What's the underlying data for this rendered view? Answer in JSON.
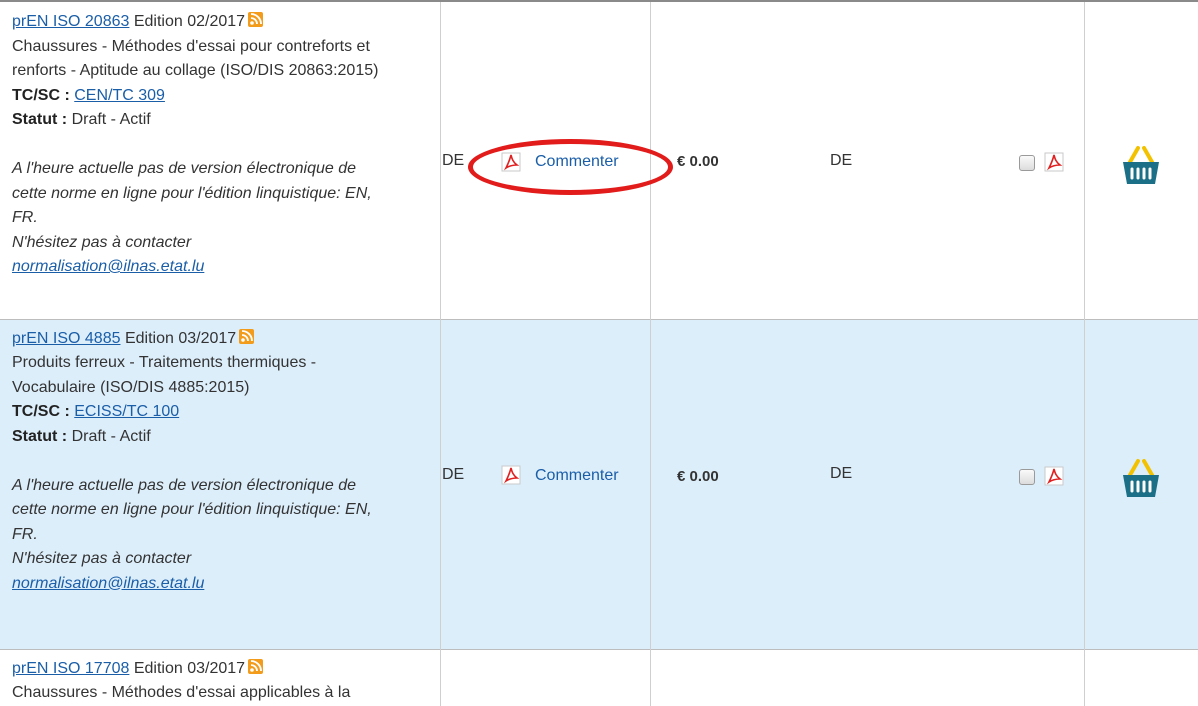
{
  "rows": [
    {
      "std_link": "prEN ISO 20863",
      "edition": "Edition 02/2017",
      "title_lines": [
        "Chaussures - Méthodes d'essai pour contreforts et",
        "renforts - Aptitude au collage (ISO/DIS 20863:2015)"
      ],
      "tc_label": "TC/SC :",
      "tc_link": "CEN/TC 309",
      "status_label": "Statut :",
      "status_value": "Draft - Actif",
      "note_lines": [
        "A l'heure actuelle pas de version électronique de",
        "cette norme en ligne pour l'édition linquistique: EN,",
        "FR.",
        "N'hésitez pas à contacter"
      ],
      "email": "normalisation@ilnas.etat.lu",
      "lang": "DE",
      "commenter": "Commenter",
      "price": "€ 0.00",
      "lang2": "DE"
    },
    {
      "std_link": "prEN ISO 4885",
      "edition": "Edition 03/2017",
      "title_lines": [
        "Produits ferreux - Traitements thermiques -",
        "Vocabulaire (ISO/DIS 4885:2015)"
      ],
      "tc_label": "TC/SC :",
      "tc_link": "ECISS/TC 100",
      "status_label": "Statut :",
      "status_value": "Draft - Actif",
      "note_lines": [
        "A l'heure actuelle pas de version électronique de",
        "cette norme en ligne pour l'édition linquistique: EN,",
        "FR.",
        "N'hésitez pas à contacter"
      ],
      "email": "normalisation@ilnas.etat.lu",
      "lang": "DE",
      "commenter": "Commenter",
      "price": "€ 0.00",
      "lang2": "DE"
    },
    {
      "std_link": "prEN ISO 17708",
      "edition": "Edition 03/2017",
      "title_lines": [
        "Chaussures - Méthodes d'essai applicables à la"
      ]
    }
  ],
  "colors": {
    "link": "#1a5ea8",
    "highlight_circle": "#e21b1b",
    "row_alt_bg": "#ddeefb",
    "rss": "#f39c1c",
    "basket": "#1b6f86",
    "basket_handle": "#f2c200"
  }
}
